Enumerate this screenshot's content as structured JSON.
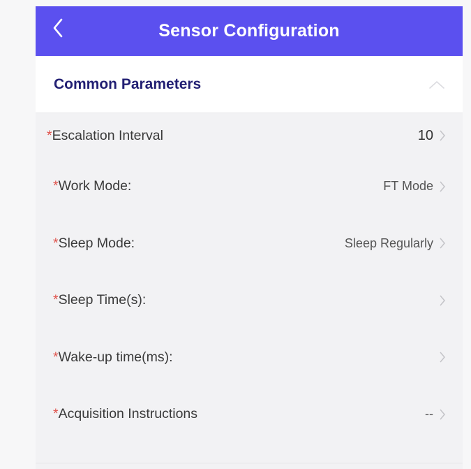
{
  "header": {
    "title": "Sensor Configuration",
    "back_icon": "chevron-left-icon"
  },
  "section": {
    "label": "Common Parameters",
    "collapse_icon": "chevron-up-icon"
  },
  "rows": [
    {
      "required_mark": "*",
      "label": "Escalation Interval",
      "value": "10"
    },
    {
      "required_mark": "*",
      "label": "Work Mode:",
      "value": "FT Mode"
    },
    {
      "required_mark": "*",
      "label": "Sleep Mode:",
      "value": "Sleep Regularly"
    },
    {
      "required_mark": "*",
      "label": "Sleep Time(s):",
      "value": ""
    },
    {
      "required_mark": "*",
      "label": "Wake-up time(ms):",
      "value": ""
    },
    {
      "required_mark": "*",
      "label": "Acquisition Instructions",
      "value": "--"
    }
  ],
  "colors": {
    "header_bg": "#5b50ef",
    "section_label": "#221f73",
    "required": "#e0524b"
  }
}
